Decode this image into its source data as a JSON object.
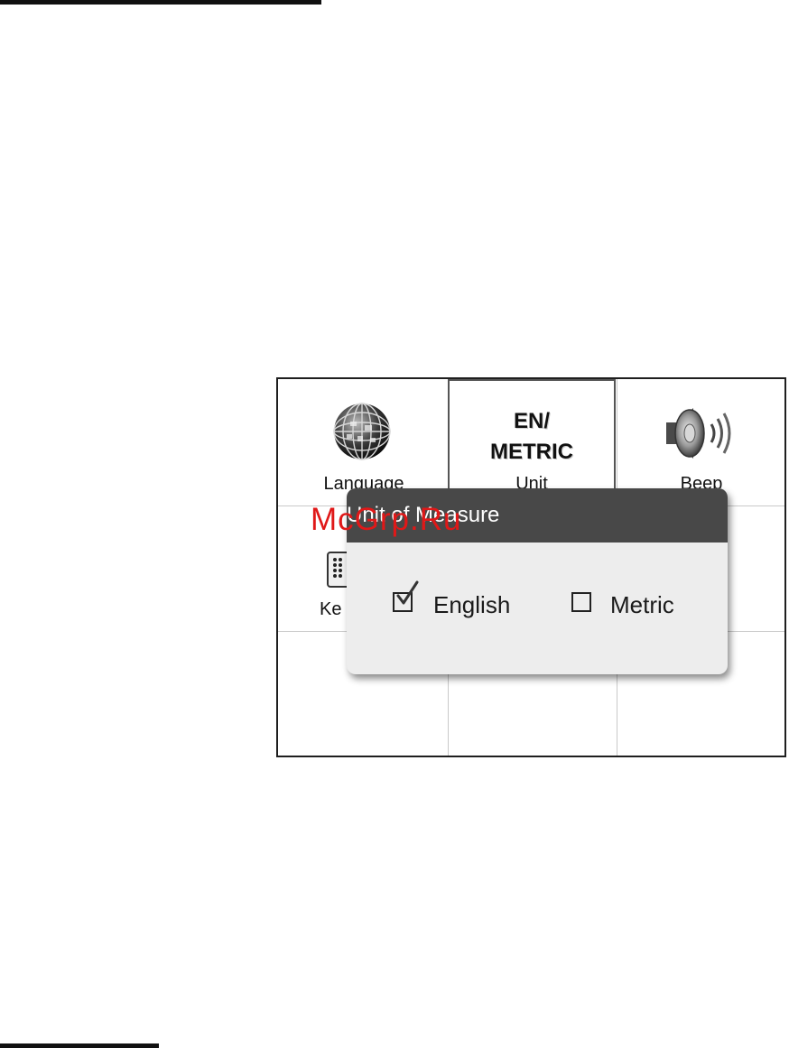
{
  "device_grid": {
    "row1": [
      {
        "label": "Language",
        "icon": "globe-icon"
      },
      {
        "label": "Unit",
        "icon": "en-metric-icon",
        "icon_text_line1": "EN/",
        "icon_text_line2": "METRIC"
      },
      {
        "label": "Beep",
        "icon": "speaker-icon"
      }
    ],
    "row2": [
      {
        "label": "Ke",
        "icon": "keypad-icon"
      }
    ]
  },
  "dialog": {
    "title": "Unit of Measure",
    "options": [
      {
        "label": "English",
        "checked": true
      },
      {
        "label": "Metric",
        "checked": false
      }
    ]
  },
  "watermark": "McGrp.Ru",
  "colors": {
    "dialog_header": "#484848",
    "dialog_body": "#ededed",
    "watermark": "#e01818"
  }
}
